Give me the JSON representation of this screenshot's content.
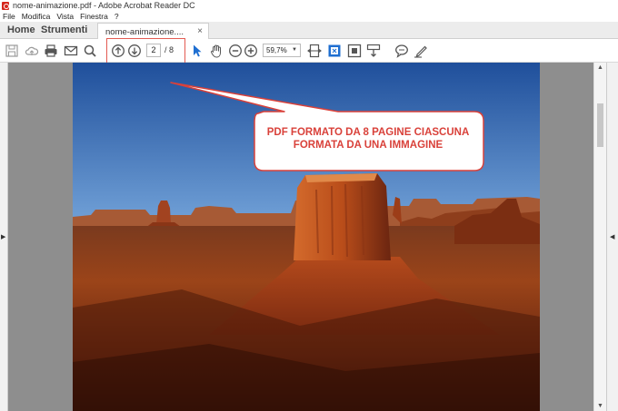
{
  "window": {
    "title": "nome-animazione.pdf - Adobe Acrobat Reader DC"
  },
  "menu": [
    "File",
    "Modifica",
    "Vista",
    "Finestra",
    "?"
  ],
  "tabs": {
    "home": "Home",
    "tools": "Strumenti",
    "document": "nome-animazione....",
    "close": "×"
  },
  "toolbar": {
    "icons": [
      "save-icon",
      "upload-icon",
      "print-icon",
      "email-icon",
      "search-icon",
      "previous-page-icon",
      "next-page-icon",
      "select-cursor-icon",
      "hand-tool-icon",
      "zoom-out-icon",
      "zoom-in-icon",
      "fit-width-icon",
      "fit-page-icon",
      "full-screen-icon",
      "scroll-mode-icon",
      "comment-icon",
      "sign-icon"
    ],
    "current_page": "2",
    "total_pages": "/ 8",
    "zoom": "59,7%"
  },
  "callout": {
    "line1": "PDF FORMATO DA 8 PAGINE CIASCUNA",
    "line2": "FORMATA DA UNA IMMAGINE"
  },
  "colors": {
    "accent_blue": "#1f6fd1",
    "annotation_red": "#d9413a"
  }
}
